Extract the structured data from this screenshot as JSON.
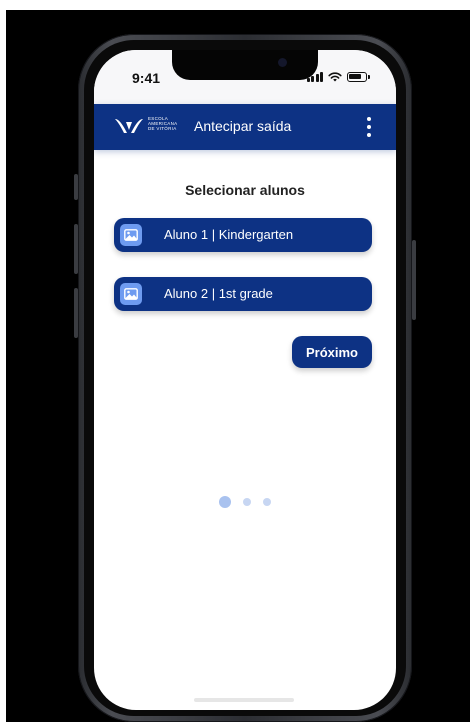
{
  "status_bar": {
    "time": "9:41"
  },
  "header": {
    "logo_lines": [
      "ESCOLA",
      "AMERICANA",
      "DE VITÓRIA"
    ],
    "title": "Antecipar saída"
  },
  "main": {
    "section_title": "Selecionar alunos",
    "students": [
      {
        "label": "Aluno 1 | Kindergarten",
        "icon": "image-icon"
      },
      {
        "label": "Aluno 2 | 1st grade",
        "icon": "image-icon"
      }
    ],
    "next_label": "Próximo"
  },
  "pagination": {
    "total": 3,
    "active": 0
  },
  "colors": {
    "primary": "#0d3284",
    "icon_bg": "#6e9bf0",
    "dot_active": "#a9c2ef",
    "dot_inactive": "#c7d6f2"
  }
}
